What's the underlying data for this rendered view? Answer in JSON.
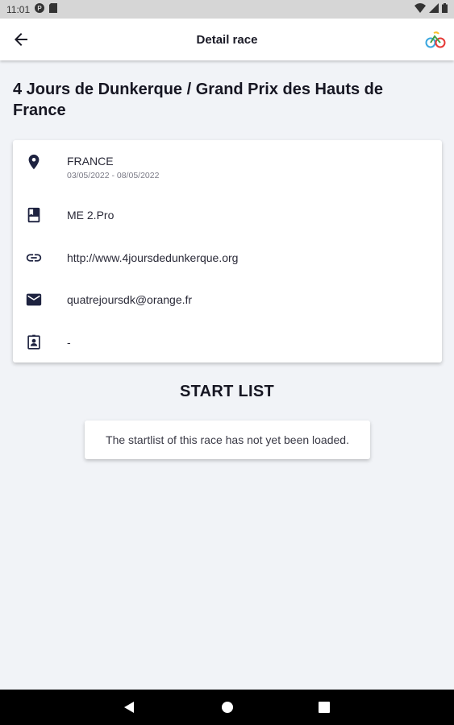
{
  "status_bar": {
    "time": "11:01",
    "left_icons": [
      "p-icon",
      "sd-card-icon"
    ],
    "right_icons": [
      "wifi-icon",
      "signal-icon",
      "battery-icon"
    ]
  },
  "app_bar": {
    "title": "Detail race",
    "back_icon": "arrow-back-icon",
    "logo_icon": "cycling-app-logo"
  },
  "race": {
    "title": "4 Jours de Dunkerque / Grand Prix des Hauts de France",
    "country": "FRANCE",
    "dates": "03/05/2022 - 08/05/2022",
    "category": "ME 2.Pro",
    "website": "http://www.4joursdedunkerque.org",
    "email": "quatrejoursdk@orange.fr",
    "contact": "-"
  },
  "icons": {
    "location": "location-pin-icon",
    "category": "bookmark-icon",
    "website": "link-icon",
    "email": "mail-icon",
    "contact": "contact-card-icon"
  },
  "start_list": {
    "title": "START LIST",
    "empty_message": "The startlist of this race has not yet been loaded."
  },
  "nav_bar": {
    "buttons": [
      "back-triangle-icon",
      "home-circle-icon",
      "recents-square-icon"
    ]
  },
  "colors": {
    "background": "#f1f3f7",
    "card": "#ffffff",
    "icon": "#1e2340",
    "text_dark": "#161622",
    "status_bar": "#d6d6d6",
    "nav_bar": "#000000"
  }
}
